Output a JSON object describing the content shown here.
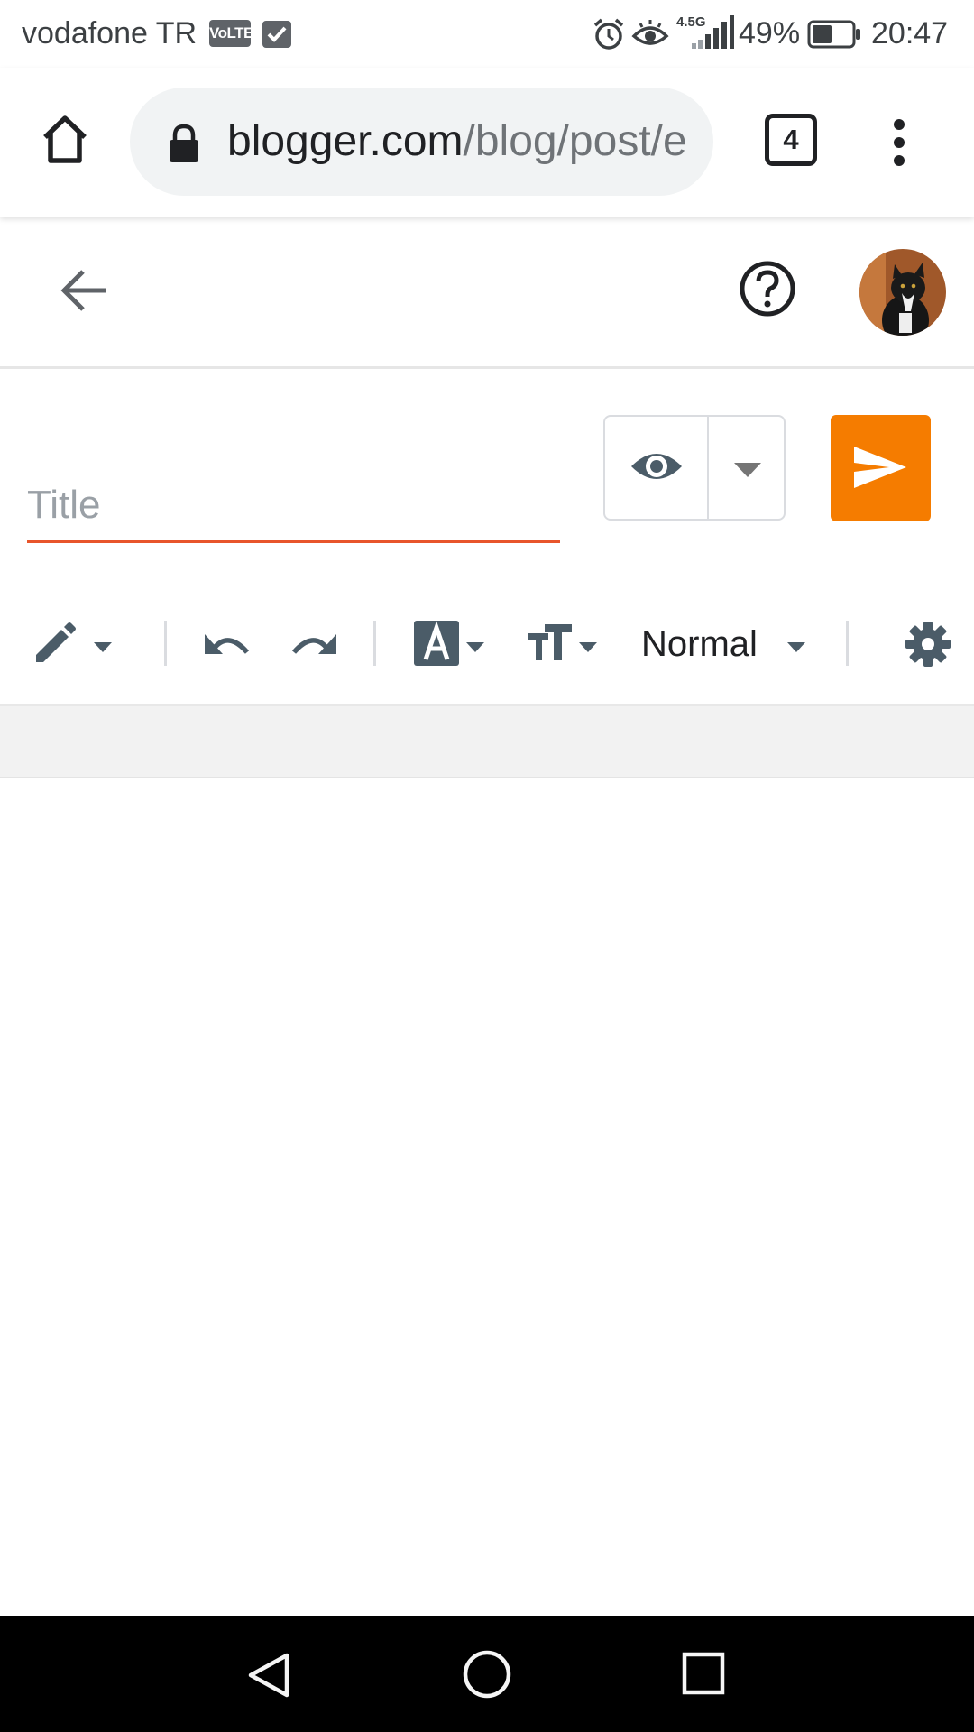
{
  "status_bar": {
    "carrier": "vodafone TR",
    "volte_badge": "VoLTE",
    "network_type": "4.5G",
    "battery_percent": "49%",
    "battery_level": 0.49,
    "time": "20:47",
    "icons": [
      "volte-badge-icon",
      "task-check-icon",
      "alarm-icon",
      "eye-comfort-icon",
      "signal-icon",
      "battery-icon"
    ]
  },
  "browser": {
    "url_host": "blogger.com",
    "url_path": "/blog/post/e",
    "tab_count": "4",
    "icons": [
      "home-icon",
      "lock-icon",
      "tabs-icon",
      "more-vert-icon"
    ]
  },
  "header": {
    "icons": [
      "back-arrow-icon",
      "help-icon",
      "avatar"
    ]
  },
  "editor": {
    "title_placeholder": "Title",
    "title_value": "",
    "accent_color": "#e8552b",
    "publish_color": "#f57c00",
    "icons": [
      "preview-eye-icon",
      "caret-down-icon",
      "send-icon"
    ]
  },
  "toolbar": {
    "paragraph_style": "Normal",
    "icon_color": "#4b5c68",
    "icons": [
      "pencil-icon",
      "undo-icon",
      "redo-icon",
      "text-color-icon",
      "font-size-icon",
      "settings-gear-icon"
    ]
  },
  "nav_bar": {
    "icons": [
      "nav-back-icon",
      "nav-home-icon",
      "nav-recents-icon"
    ]
  }
}
